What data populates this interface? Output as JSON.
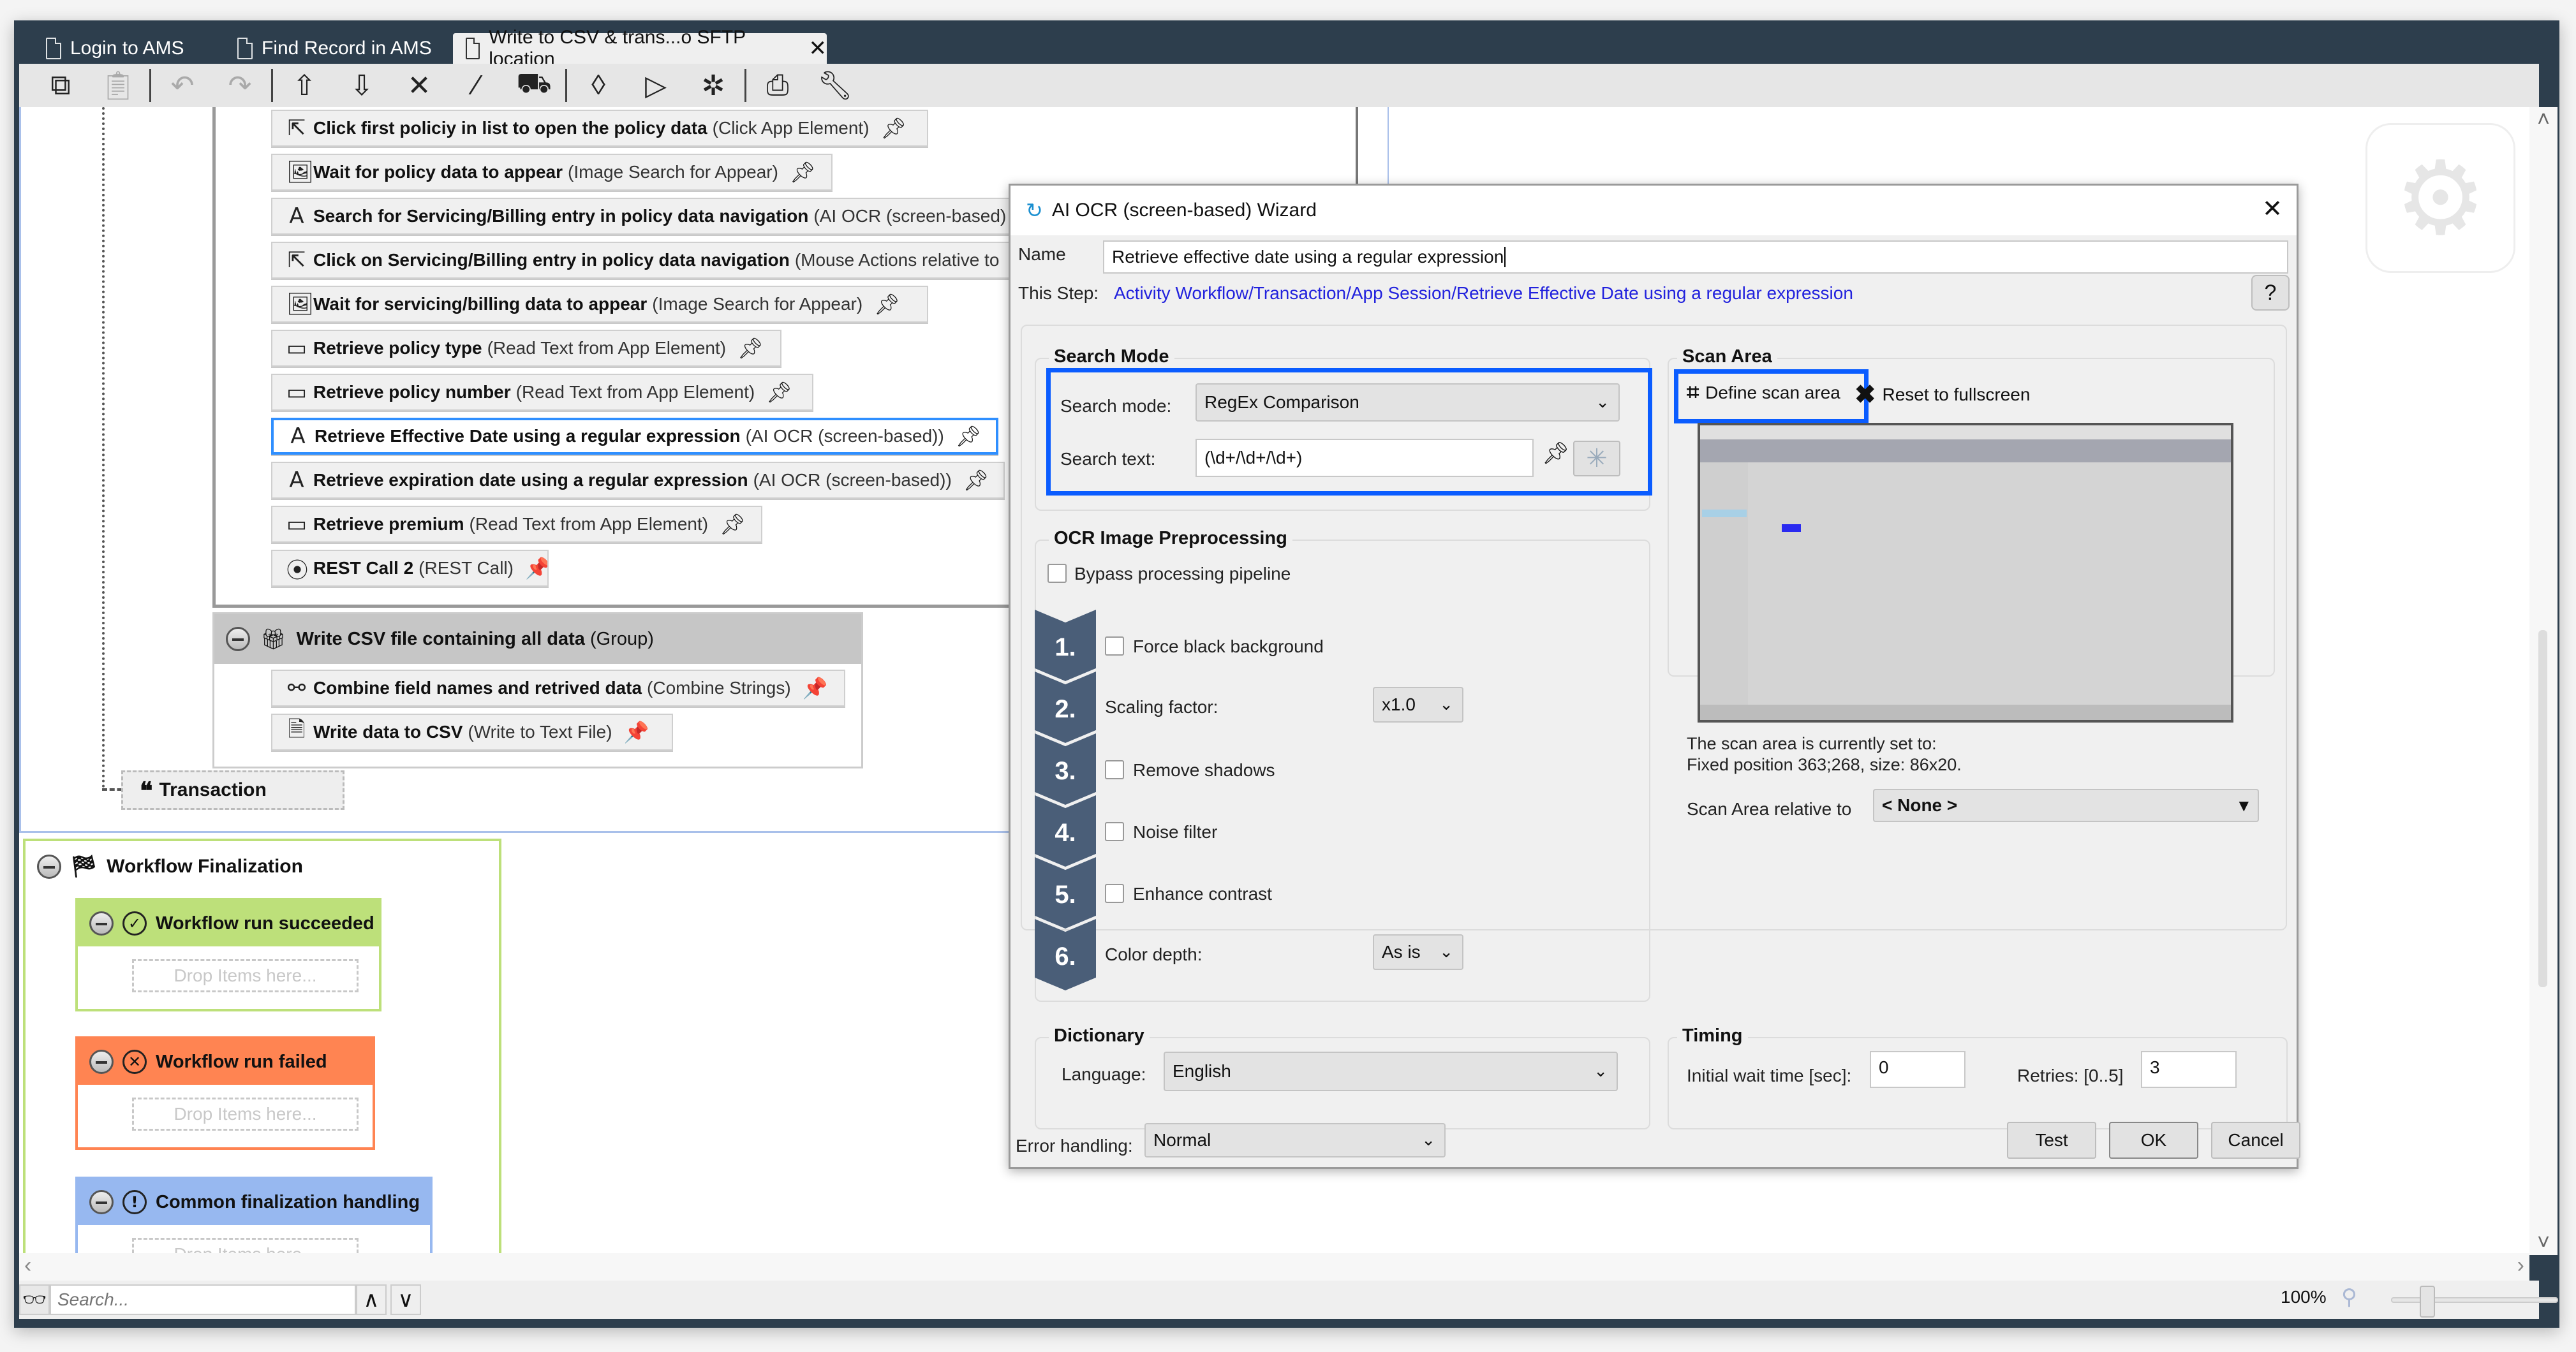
{
  "tabs": [
    {
      "label": "Login to AMS",
      "active": false
    },
    {
      "label": "Find Record in AMS",
      "active": false
    },
    {
      "label": "Write to CSV & trans...o SFTP location",
      "active": true
    }
  ],
  "toolbar": {
    "icons": [
      "copy-icon",
      "paste-icon",
      "undo-icon",
      "redo-icon",
      "move-up-icon",
      "move-down-icon",
      "delete-icon",
      "magic-wand-icon",
      "truck-icon",
      "diamond-icon",
      "run-icon",
      "debug-icon",
      "print-icon",
      "wrench-icon"
    ]
  },
  "workflow": {
    "steps": [
      {
        "icon": "cursor-icon",
        "name": "Click first policiy in list to open the policy data",
        "type": "(Click App Element)",
        "pinned": false
      },
      {
        "icon": "image-icon",
        "name": "Wait for policy data to appear",
        "type": "(Image Search for Appear)",
        "pinned": false
      },
      {
        "icon": "ocr-icon",
        "name": "Search for Servicing/Billing entry in policy data navigation",
        "type": "(AI OCR (screen-based)",
        "pinned": false
      },
      {
        "icon": "cursor-icon",
        "name": "Click on Servicing/Billing entry in policy data navigation",
        "type": "(Mouse Actions relative to",
        "pinned": false
      },
      {
        "icon": "image-icon",
        "name": "Wait for servicing/billing data to appear",
        "type": "(Image Search for Appear)",
        "pinned": false
      },
      {
        "icon": "textfield-icon",
        "name": "Retrieve policy type",
        "type": "(Read Text from App Element)",
        "pinned": false
      },
      {
        "icon": "textfield-icon",
        "name": "Retrieve policy number",
        "type": "(Read Text from App Element)",
        "pinned": false
      },
      {
        "icon": "ocr-icon",
        "name": "Retrieve Effective Date using a regular expression",
        "type": "(AI OCR (screen-based))",
        "pinned": false,
        "selected": true
      },
      {
        "icon": "ocr-icon",
        "name": "Retrieve expiration date using a regular expression",
        "type": "(AI OCR (screen-based))",
        "pinned": false
      },
      {
        "icon": "textfield-icon",
        "name": "Retrieve premium",
        "type": "(Read Text from App Element)",
        "pinned": false
      },
      {
        "icon": "rest-icon",
        "name": "REST Call 2",
        "type": "(REST Call)",
        "pinned": true
      }
    ],
    "group": {
      "name": "Write CSV file containing all data",
      "type": "(Group)",
      "steps": [
        {
          "icon": "combine-icon",
          "name": "Combine field names and retrived data",
          "type": "(Combine Strings)",
          "pinned": true
        },
        {
          "icon": "write-file-icon",
          "name": "Write data to CSV",
          "type": "(Write to Text File)",
          "pinned": true
        }
      ]
    },
    "transaction_label": "Transaction",
    "finalization": {
      "title": "Workflow Finalization",
      "blocks": [
        {
          "title": "Workflow run succeeded",
          "color": "#bde07a",
          "border": "#bde07a",
          "drop": "Drop Items here..."
        },
        {
          "title": "Workflow run failed",
          "color": "#ff8452",
          "border": "#ff8452",
          "drop": "Drop Items here..."
        },
        {
          "title": "Common finalization handling",
          "color": "#97b8f0",
          "border": "#97b8f0",
          "drop": "Drop Items here..."
        }
      ]
    }
  },
  "dialog": {
    "title": "AI OCR (screen-based) Wizard",
    "name_label": "Name",
    "name_value": "Retrieve effective date using a regular expression",
    "step_label": "This Step:",
    "step_path": "Activity Workflow/Transaction/App Session/Retrieve Effective Date using a regular expression",
    "search_mode": {
      "title": "Search Mode",
      "mode_label": "Search mode:",
      "mode_value": "RegEx Comparison",
      "text_label": "Search text:",
      "text_value": "(\\d+/\\d+/\\d+)"
    },
    "scan_area": {
      "title": "Scan Area",
      "define_label": "Define scan area",
      "reset_label": "Reset to fullscreen",
      "status_line1": "The scan area is currently set to:",
      "status_line2": "Fixed position 363;268, size: 86x20.",
      "relative_label": "Scan Area relative to",
      "relative_value": "< None >"
    },
    "preprocessing": {
      "title": "OCR Image Preprocessing",
      "bypass_label": "Bypass processing pipeline",
      "bypass_checked": false,
      "steps": [
        {
          "num": "1.",
          "label": "Force black background",
          "kind": "checkbox",
          "checked": false
        },
        {
          "num": "2.",
          "label": "Scaling factor:",
          "kind": "select",
          "value": "x1.0"
        },
        {
          "num": "3.",
          "label": "Remove shadows",
          "kind": "checkbox",
          "checked": false
        },
        {
          "num": "4.",
          "label": "Noise filter",
          "kind": "checkbox",
          "checked": false
        },
        {
          "num": "5.",
          "label": "Enhance contrast",
          "kind": "checkbox",
          "checked": false
        },
        {
          "num": "6.",
          "label": "Color depth:",
          "kind": "select",
          "value": "As is"
        }
      ]
    },
    "dictionary": {
      "title": "Dictionary",
      "language_label": "Language:",
      "language_value": "English"
    },
    "timing": {
      "title": "Timing",
      "wait_label": "Initial wait time [sec]:",
      "wait_value": "0",
      "retries_label": "Retries: [0..5]",
      "retries_value": "3"
    },
    "error_label": "Error handling:",
    "error_value": "Normal",
    "buttons": {
      "test": "Test",
      "ok": "OK",
      "cancel": "Cancel"
    }
  },
  "bottom": {
    "search_placeholder": "Search...",
    "zoom_level": "100%",
    "zoom_fraction": 0.18
  },
  "colors": {
    "accent_blue": "#0a5cff",
    "chrome": "#2d3e4d",
    "step_chevron": "#4a5e78",
    "link": "#2222dd"
  }
}
